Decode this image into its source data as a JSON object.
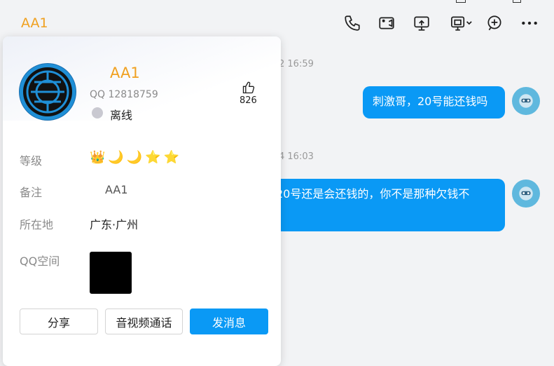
{
  "chat": {
    "title": "AA1",
    "timestamps": [
      "2 16:59",
      "4 16:03"
    ],
    "messages": [
      {
        "text": "刺激哥，20号能还钱吗"
      },
      {
        "text": "20号还是会还钱的，你不是那种欠钱不"
      }
    ]
  },
  "toolbar": {
    "icons": [
      "phone-icon",
      "video-call-icon",
      "screen-share-icon",
      "remote-desktop-icon",
      "add-icon",
      "more-icon"
    ]
  },
  "profile": {
    "name": "AA1",
    "qq": "QQ 12818759",
    "status": "离线",
    "likes": "826",
    "fields": {
      "level_label": "等级",
      "remark_label": "备注",
      "remark_value": "AA1",
      "location_label": "所在地",
      "location_value": "广东·广州",
      "qzone_label": "QQ空间"
    },
    "level_icons": [
      "👑",
      "🌙",
      "🌙",
      "⭐",
      "⭐"
    ],
    "buttons": {
      "share": "分享",
      "av_call": "音视频通话",
      "send_message": "发消息"
    }
  },
  "colors": {
    "accent": "#0a99f5",
    "name": "#f0a020",
    "background": "#f2f3f5"
  }
}
